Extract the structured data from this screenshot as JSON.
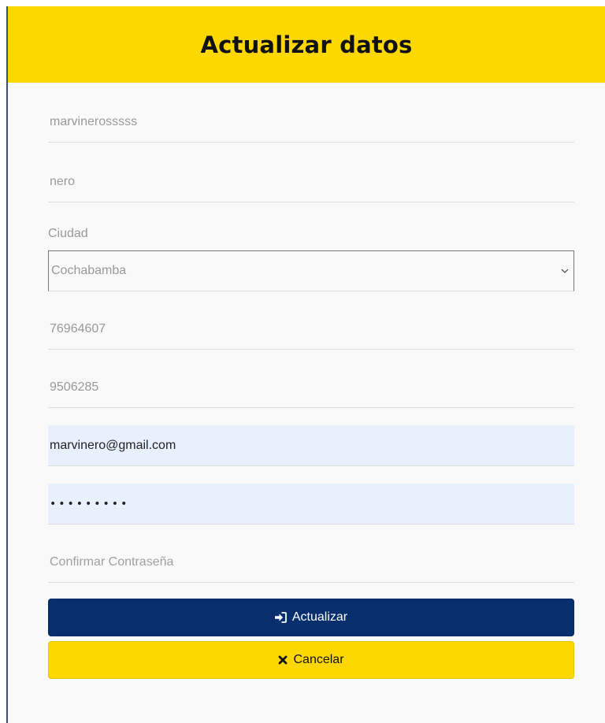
{
  "modal": {
    "title": "Actualizar datos"
  },
  "form": {
    "username": {
      "value": "marvinerosssss"
    },
    "lastname": {
      "value": "nero"
    },
    "city": {
      "label": "Ciudad",
      "selected": "Cochabamba"
    },
    "phone": {
      "value": "76964607"
    },
    "ci": {
      "value": "9506285"
    },
    "email": {
      "value": "marvinero@gmail.com"
    },
    "password": {
      "value": "•••••••••"
    },
    "confirm_password": {
      "placeholder": "Confirmar Contraseña"
    }
  },
  "buttons": {
    "update": {
      "label": "Actualizar",
      "icon": "sign-in-icon"
    },
    "cancel": {
      "label": "Cancelar",
      "icon": "close-icon"
    }
  },
  "colors": {
    "header_bg": "#fdd800",
    "primary_button": "#072f6e",
    "secondary_button": "#fdd800",
    "autofill_bg": "#e8f0fe"
  }
}
